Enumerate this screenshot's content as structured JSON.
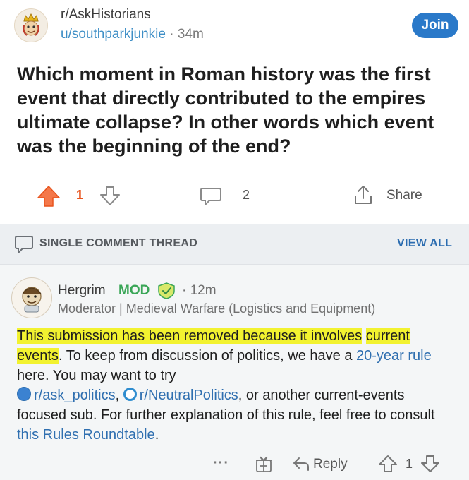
{
  "post": {
    "subreddit": "r/AskHistorians",
    "author": "u/southparkjunkie",
    "separator": "·",
    "age": "34m",
    "join_label": "Join",
    "title": "Which moment in Roman history was the first event that directly contributed to the empires ultimate collapse? In other words which event was the beginning of the end?",
    "score": "1",
    "comment_count": "2",
    "share_label": "Share"
  },
  "thread": {
    "label": "SINGLE COMMENT THREAD",
    "view_all": "VIEW ALL"
  },
  "comment": {
    "author": "Hergrim",
    "mod_tag": "MOD",
    "separator": "·",
    "age": "12m",
    "flair": "Moderator | Medieval Warfare (Logistics and Equipment)",
    "highlight_1": "This submission has been removed because it involves",
    "highlight_2": "current events",
    "text_1": ".  To keep from discussion of politics, we have a ",
    "link_rule": "20-year rule",
    "text_2": " here.  You may want to try ",
    "link_ask_politics": "r/ask_politics",
    "text_3": ", ",
    "link_neutral": "r/NeutralPolitics",
    "text_4": ", or another current-events focused sub. For further explanation of this rule, feel free to consult ",
    "link_roundtable": "this Rules Roundtable",
    "text_5": ".",
    "more_label": "···",
    "reply_label": "Reply",
    "score": "1"
  },
  "colors": {
    "upvote": "#e8531c",
    "join": "#2a79c9",
    "mod": "#3aa657",
    "link": "#2f6fb0",
    "highlight": "#f2f230"
  },
  "icons": [
    "subreddit-avatar-icon",
    "upvote-icon",
    "downvote-icon",
    "comment-icon",
    "share-icon",
    "chat-bubble-icon",
    "user-avatar-icon",
    "mod-shield-icon",
    "more-icon",
    "award-icon",
    "reply-icon"
  ]
}
